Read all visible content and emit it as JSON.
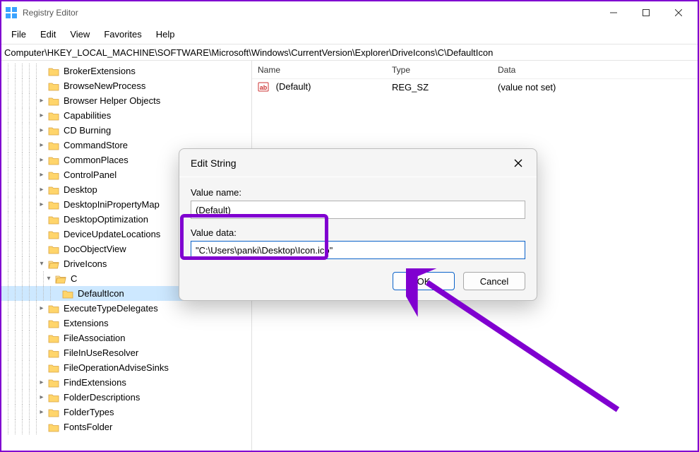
{
  "titlebar": {
    "title": "Registry Editor"
  },
  "menubar": {
    "items": [
      "File",
      "Edit",
      "View",
      "Favorites",
      "Help"
    ]
  },
  "addressbar": {
    "path": "Computer\\HKEY_LOCAL_MACHINE\\SOFTWARE\\Microsoft\\Windows\\CurrentVersion\\Explorer\\DriveIcons\\C\\DefaultIcon"
  },
  "tree": {
    "items": [
      {
        "depth": 5,
        "twisty": "",
        "label": "BrokerExtensions",
        "open": false
      },
      {
        "depth": 5,
        "twisty": "",
        "label": "BrowseNewProcess",
        "open": false
      },
      {
        "depth": 5,
        "twisty": ">",
        "label": "Browser Helper Objects",
        "open": false
      },
      {
        "depth": 5,
        "twisty": ">",
        "label": "Capabilities",
        "open": false
      },
      {
        "depth": 5,
        "twisty": ">",
        "label": "CD Burning",
        "open": false
      },
      {
        "depth": 5,
        "twisty": ">",
        "label": "CommandStore",
        "open": false
      },
      {
        "depth": 5,
        "twisty": ">",
        "label": "CommonPlaces",
        "open": false
      },
      {
        "depth": 5,
        "twisty": ">",
        "label": "ControlPanel",
        "open": false
      },
      {
        "depth": 5,
        "twisty": ">",
        "label": "Desktop",
        "open": false
      },
      {
        "depth": 5,
        "twisty": ">",
        "label": "DesktopIniPropertyMap",
        "open": false
      },
      {
        "depth": 5,
        "twisty": "",
        "label": "DesktopOptimization",
        "open": false
      },
      {
        "depth": 5,
        "twisty": "",
        "label": "DeviceUpdateLocations",
        "open": false
      },
      {
        "depth": 5,
        "twisty": "",
        "label": "DocObjectView",
        "open": false
      },
      {
        "depth": 5,
        "twisty": "v",
        "label": "DriveIcons",
        "open": true
      },
      {
        "depth": 6,
        "twisty": "v",
        "label": "C",
        "open": true
      },
      {
        "depth": 7,
        "twisty": "",
        "label": "DefaultIcon",
        "open": false,
        "selected": true
      },
      {
        "depth": 5,
        "twisty": ">",
        "label": "ExecuteTypeDelegates",
        "open": false
      },
      {
        "depth": 5,
        "twisty": "",
        "label": "Extensions",
        "open": false
      },
      {
        "depth": 5,
        "twisty": "",
        "label": "FileAssociation",
        "open": false
      },
      {
        "depth": 5,
        "twisty": "",
        "label": "FileInUseResolver",
        "open": false
      },
      {
        "depth": 5,
        "twisty": "",
        "label": "FileOperationAdviseSinks",
        "open": false
      },
      {
        "depth": 5,
        "twisty": ">",
        "label": "FindExtensions",
        "open": false
      },
      {
        "depth": 5,
        "twisty": ">",
        "label": "FolderDescriptions",
        "open": false
      },
      {
        "depth": 5,
        "twisty": ">",
        "label": "FolderTypes",
        "open": false
      },
      {
        "depth": 5,
        "twisty": "",
        "label": "FontsFolder",
        "open": false
      }
    ]
  },
  "list": {
    "columns": [
      "Name",
      "Type",
      "Data"
    ],
    "rows": [
      {
        "name": "(Default)",
        "type": "REG_SZ",
        "data": "(value not set)"
      }
    ]
  },
  "dialog": {
    "title": "Edit String",
    "value_name_label": "Value name:",
    "value_name": "(Default)",
    "value_data_label": "Value data:",
    "value_data": "\"C:\\Users\\panki\\Desktop\\Icon.ico\"",
    "ok": "OK",
    "cancel": "Cancel"
  }
}
